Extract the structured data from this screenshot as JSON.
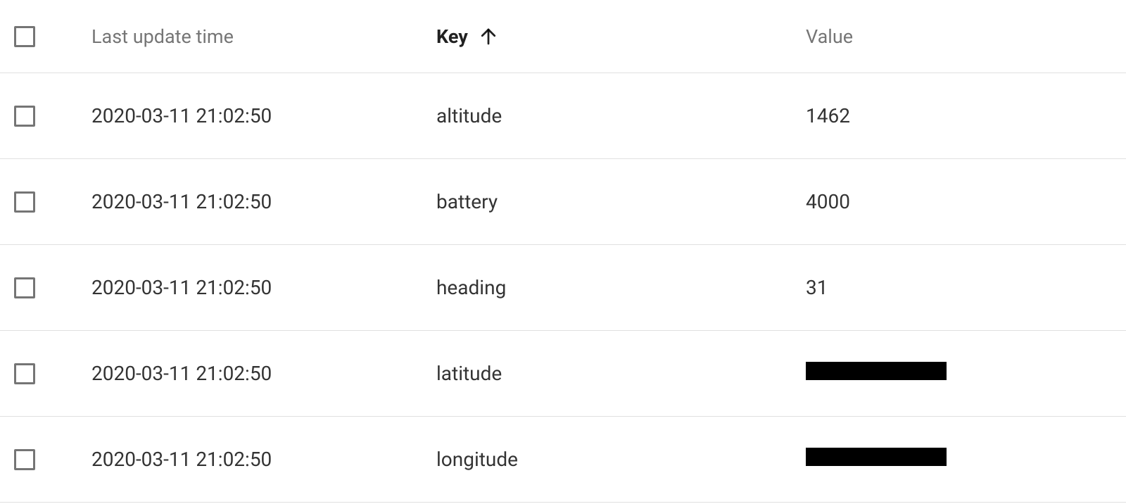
{
  "table": {
    "headers": {
      "time": "Last update time",
      "key": "Key",
      "value": "Value"
    },
    "sort": {
      "column": "key",
      "direction": "asc"
    },
    "rows": [
      {
        "time": "2020-03-11 21:02:50",
        "key": "altitude",
        "value": "1462",
        "redacted": false
      },
      {
        "time": "2020-03-11 21:02:50",
        "key": "battery",
        "value": "4000",
        "redacted": false
      },
      {
        "time": "2020-03-11 21:02:50",
        "key": "heading",
        "value": "31",
        "redacted": false
      },
      {
        "time": "2020-03-11 21:02:50",
        "key": "latitude",
        "value": "",
        "redacted": true
      },
      {
        "time": "2020-03-11 21:02:50",
        "key": "longitude",
        "value": "",
        "redacted": true
      }
    ]
  }
}
